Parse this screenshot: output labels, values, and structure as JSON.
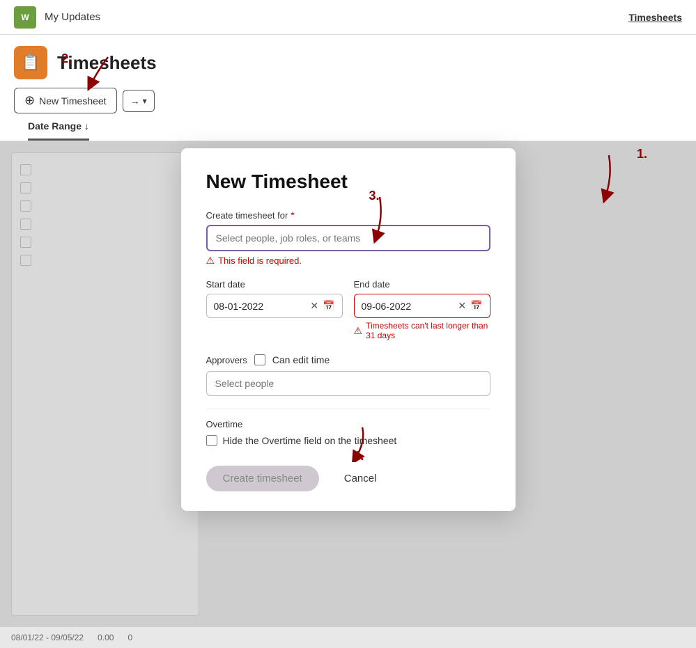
{
  "app": {
    "nav_label": "My Updates",
    "logo_text": "W"
  },
  "header": {
    "page_title": "Timesheets",
    "page_icon": "📋",
    "nav_timesheets": "Timesheets",
    "new_timesheet_btn": "New Timesheet",
    "export_btn": "→",
    "annotation_1": "1.",
    "annotation_2": "2.",
    "tabs": [
      {
        "label": "Date Range ↓",
        "active": true
      }
    ]
  },
  "modal": {
    "title": "New Timesheet",
    "create_for_label": "Create timesheet for",
    "create_for_placeholder": "Select people, job roles, or teams",
    "required_error": "This field is required.",
    "start_date_label": "Start date",
    "start_date_value": "08-01-2022",
    "end_date_label": "End date",
    "end_date_value": "09-06-2022",
    "end_date_error": "Timesheets can't last longer than 31 days",
    "approvers_label": "Approvers",
    "can_edit_label": "Can edit time",
    "select_people_placeholder": "Select people",
    "overtime_label": "Overtime",
    "overtime_checkbox_label": "Hide the Overtime field on the timesheet",
    "create_btn": "Create timesheet",
    "cancel_btn": "Cancel",
    "annotation_3": "3.",
    "annotation_4": "4."
  },
  "bottom": {
    "date_range_text": "08/01/22 - 09/05/22",
    "value": "0.00",
    "zero": "0"
  }
}
